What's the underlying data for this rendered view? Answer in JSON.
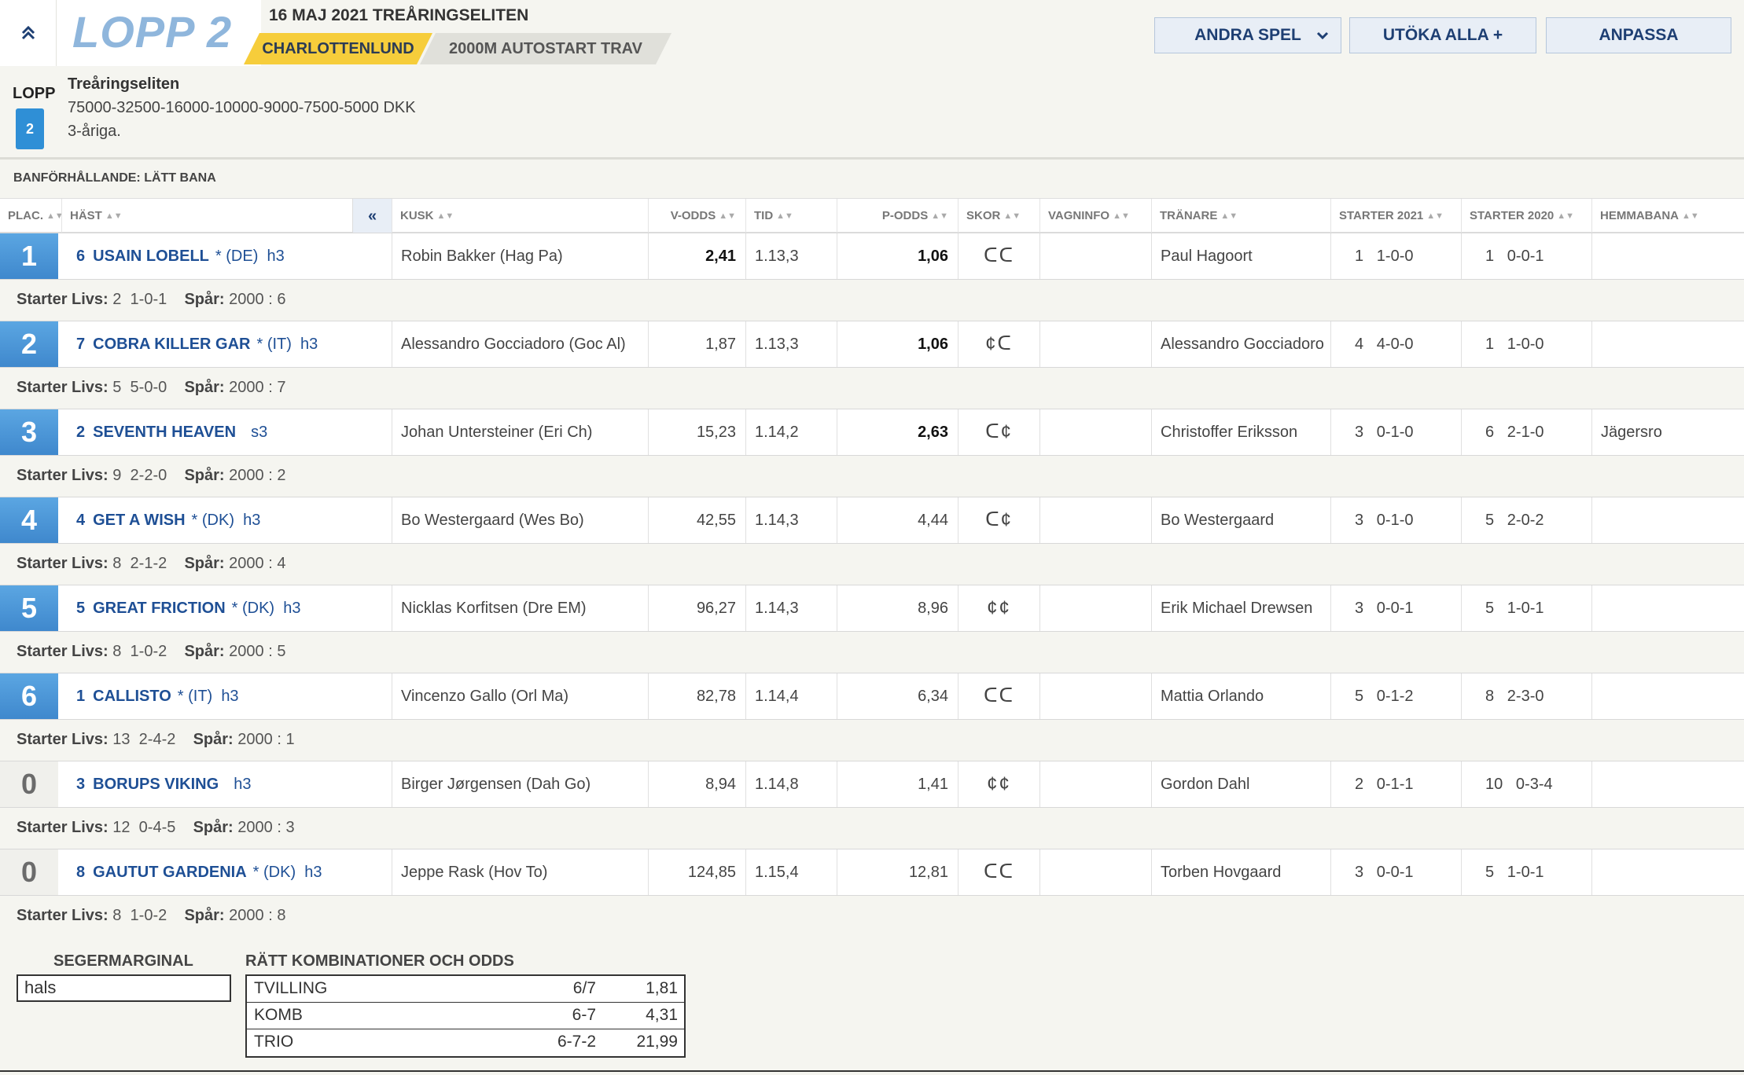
{
  "header": {
    "lopp_title": "LOPP 2",
    "date_title": "16 MAJ 2021 TREÅRINGSELITEN",
    "track": "CHARLOTTENLUND",
    "distance": "2000M AUTOSTART TRAV",
    "buttons": {
      "andra_spel": "ANDRA SPEL",
      "utoka_alla": "UTÖKA ALLA +",
      "anpassa": "ANPASSA"
    }
  },
  "race_info": {
    "lopp_label": "LOPP",
    "lopp_number": "2",
    "name": "Treåringseliten",
    "prizes": "75000-32500-16000-10000-9000-7500-5000 DKK",
    "age": "3-åriga."
  },
  "track_condition": "BANFÖRHÅLLANDE: LÄTT BANA",
  "columns": {
    "plac": "PLAC.",
    "hast": "HÄST",
    "collapse": "«",
    "kusk": "KUSK",
    "v_odds": "V-ODDS",
    "tid": "TID",
    "p_odds": "P-ODDS",
    "skor": "SKOR",
    "vagninfo": "VAGNINFO",
    "tranare": "TRÄNARE",
    "starter_2021": "STARTER 2021",
    "starter_2020": "STARTER 2020",
    "hemmabana": "HEMMABANA"
  },
  "starter_label": "Starter Livs:",
  "spar_label": "Spår:",
  "rows": [
    {
      "place": "1",
      "num": "6",
      "name": "USAIN LOBELL",
      "extra": "* (DE)  h3",
      "kusk": "Robin Bakker (Hag Pa)",
      "v_odds": "2,41",
      "tid": "1.13,3",
      "p_odds": "1,06",
      "skor": "ᑕᑕ",
      "vagninfo": "",
      "tranare": "Paul Hagoort",
      "s21": "1   1-0-0",
      "s20": "1   0-0-1",
      "hemma": "",
      "liv_count": "2",
      "liv_rec": "1-0-1",
      "spar": "2000 : 6"
    },
    {
      "place": "2",
      "num": "7",
      "name": "COBRA KILLER GAR",
      "extra": "* (IT)  h3",
      "kusk": "Alessandro Gocciadoro (Goc Al)",
      "v_odds": "1,87",
      "tid": "1.13,3",
      "p_odds": "1,06",
      "skor": "¢ᑕ",
      "vagninfo": "",
      "tranare": "Alessandro Gocciadoro",
      "s21": "4   4-0-0",
      "s20": "1   1-0-0",
      "hemma": "",
      "liv_count": "5",
      "liv_rec": "5-0-0",
      "spar": "2000 : 7"
    },
    {
      "place": "3",
      "num": "2",
      "name": "SEVENTH HEAVEN",
      "extra": "  s3",
      "kusk": "Johan Untersteiner (Eri Ch)",
      "v_odds": "15,23",
      "tid": "1.14,2",
      "p_odds": "2,63",
      "skor": "ᑕ¢",
      "vagninfo": "",
      "tranare": "Christoffer Eriksson",
      "s21": "3   0-1-0",
      "s20": "6   2-1-0",
      "hemma": "Jägersro",
      "liv_count": "9",
      "liv_rec": "2-2-0",
      "spar": "2000 : 2"
    },
    {
      "place": "4",
      "num": "4",
      "name": "GET A WISH",
      "extra": "* (DK)  h3",
      "kusk": "Bo Westergaard (Wes Bo)",
      "v_odds": "42,55",
      "tid": "1.14,3",
      "p_odds": "4,44",
      "skor": "ᑕ¢",
      "vagninfo": "",
      "tranare": "Bo Westergaard",
      "s21": "3   0-1-0",
      "s20": "5   2-0-2",
      "hemma": "",
      "liv_count": "8",
      "liv_rec": "2-1-2",
      "spar": "2000 : 4"
    },
    {
      "place": "5",
      "num": "5",
      "name": "GREAT FRICTION",
      "extra": "* (DK)  h3",
      "kusk": "Nicklas Korfitsen (Dre EM)",
      "v_odds": "96,27",
      "tid": "1.14,3",
      "p_odds": "8,96",
      "skor": "¢¢",
      "vagninfo": "",
      "tranare": "Erik Michael Drewsen",
      "s21": "3   0-0-1",
      "s20": "5   1-0-1",
      "hemma": "",
      "liv_count": "8",
      "liv_rec": "1-0-2",
      "spar": "2000 : 5"
    },
    {
      "place": "6",
      "num": "1",
      "name": "CALLISTO",
      "extra": "* (IT)  h3",
      "kusk": "Vincenzo Gallo (Orl Ma)",
      "v_odds": "82,78",
      "tid": "1.14,4",
      "p_odds": "6,34",
      "skor": "ᑕᑕ",
      "vagninfo": "",
      "tranare": "Mattia Orlando",
      "s21": "5   0-1-2",
      "s20": "8   2-3-0",
      "hemma": "",
      "liv_count": "13",
      "liv_rec": "2-4-2",
      "spar": "2000 : 1"
    },
    {
      "place": "0",
      "num": "3",
      "name": "BORUPS VIKING",
      "extra": "  h3",
      "kusk": "Birger Jørgensen (Dah Go)",
      "v_odds": "8,94",
      "tid": "1.14,8",
      "p_odds": "1,41",
      "skor": "¢¢",
      "vagninfo": "",
      "tranare": "Gordon Dahl",
      "s21": "2   0-1-1",
      "s20": "10   0-3-4",
      "hemma": "",
      "liv_count": "12",
      "liv_rec": "0-4-5",
      "spar": "2000 : 3"
    },
    {
      "place": "0",
      "num": "8",
      "name": "GAUTUT GARDENIA",
      "extra": "* (DK)  h3",
      "kusk": "Jeppe Rask (Hov To)",
      "v_odds": "124,85",
      "tid": "1.15,4",
      "p_odds": "12,81",
      "skor": "ᑕᑕ",
      "vagninfo": "",
      "tranare": "Torben Hovgaard",
      "s21": "3   0-0-1",
      "s20": "5   1-0-1",
      "hemma": "",
      "liv_count": "8",
      "liv_rec": "1-0-2",
      "spar": "2000 : 8"
    }
  ],
  "bottom": {
    "segermarginal_title": "SEGERMARGINAL",
    "segermarginal_value": "hals",
    "komb_title": "RÄTT KOMBINATIONER OCH ODDS",
    "komb": [
      {
        "name": "TVILLING",
        "combo": "6/7",
        "odds": "1,81"
      },
      {
        "name": "KOMB",
        "combo": "6-7",
        "odds": "4,31"
      },
      {
        "name": "TRIO",
        "combo": "6-7-2",
        "odds": "21,99"
      }
    ]
  },
  "colors": {
    "accent_blue": "#3f88cd",
    "title_blue": "#8fb6dc",
    "horse_blue": "#1e4f95",
    "track_yellow": "#f6cd3b"
  }
}
